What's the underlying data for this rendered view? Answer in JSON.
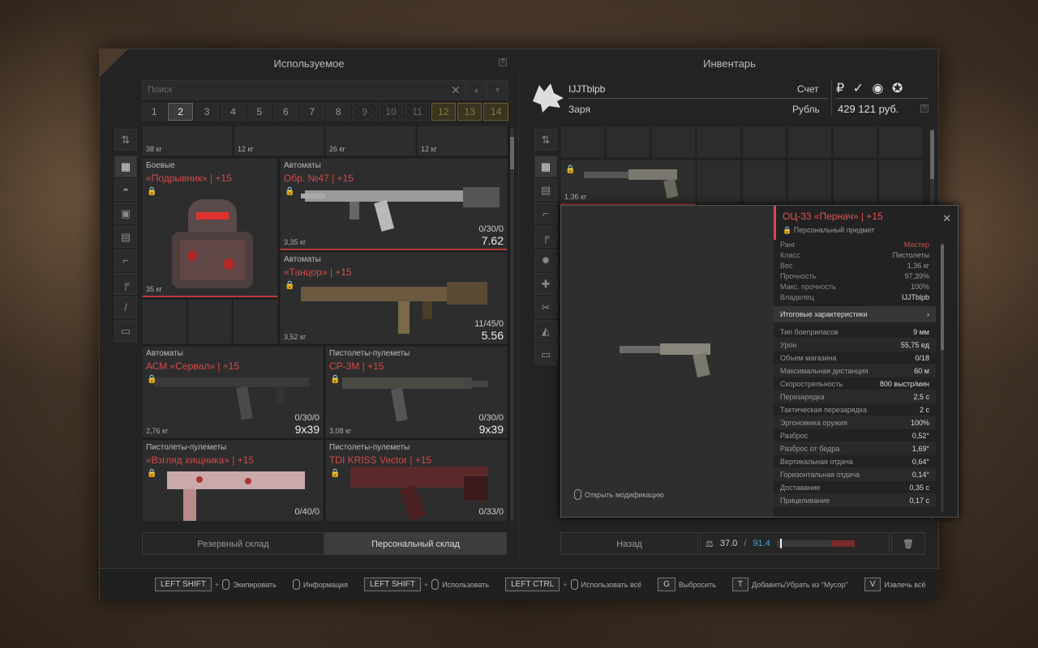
{
  "left_panel": {
    "title": "Используемое",
    "search_placeholder": "Поиск",
    "pages": [
      "1",
      "2",
      "3",
      "4",
      "5",
      "6",
      "7",
      "8",
      "9",
      "10",
      "11",
      "12",
      "13",
      "14"
    ],
    "active_page": "2",
    "top_weights": [
      "38 кг",
      "12 кг",
      "26 кг",
      "12 кг"
    ],
    "items": [
      {
        "category": "Боевые",
        "name": "«Подрывник» | +15",
        "weight": "35 кг",
        "ammo": "",
        "caliber": ""
      },
      {
        "category": "Автоматы",
        "name": "Обр. №47 | +15",
        "weight": "3,35 кг",
        "ammo": "0/30/0",
        "caliber": "7.62"
      },
      {
        "category": "Автоматы",
        "name": "«Танцор» | +15",
        "weight": "3,52 кг",
        "ammo": "11/45/0",
        "caliber": "5.56"
      },
      {
        "category": "Автоматы",
        "name": "АСМ «Сервал» | +15",
        "weight": "2,76 кг",
        "ammo": "0/30/0",
        "caliber": "9x39"
      },
      {
        "category": "Пистолеты-пулеметы",
        "name": "СР-3М | +15",
        "weight": "3,08 кг",
        "ammo": "0/30/0",
        "caliber": "9x39"
      },
      {
        "category": "Пистолеты-пулеметы",
        "name": "«Взгляд хищника» | +15",
        "weight": "",
        "ammo": "0/40/0",
        "caliber": ""
      },
      {
        "category": "Пистолеты-пулеметы",
        "name": "TDI KRISS Vector | +15",
        "weight": "",
        "ammo": "0/33/0",
        "caliber": ""
      }
    ],
    "tabs": [
      "Резервный склад",
      "Персональный склад"
    ],
    "active_tab": "Персональный склад"
  },
  "right_panel": {
    "title": "Инвентарь",
    "player_name": "IJJTblpb",
    "faction": "Заря",
    "account_label": "Счет",
    "currency_label": "Рубль",
    "money": "429 121 руб.",
    "inv_item_weight": "1,36 кг",
    "back_label": "Назад",
    "weight_current": "37.0",
    "weight_sep": "/",
    "weight_max": "91.4"
  },
  "popup": {
    "title": "ОЦ-33 «Пернач» | +15",
    "subtitle": "Персональный предмет",
    "open_mod": "Открыть модификацию",
    "info": [
      {
        "k": "Ранг",
        "v": "Мастер"
      },
      {
        "k": "Класс",
        "v": "Пистолеты"
      },
      {
        "k": "Вес",
        "v": "1,36 кг"
      },
      {
        "k": "Прочность",
        "v": "97,39%"
      },
      {
        "k": "Макс. прочность",
        "v": "100%"
      },
      {
        "k": "Владелец",
        "v": "IJJTblpb"
      }
    ],
    "summary_label": "Итоговые характеристики",
    "stats": [
      {
        "k": "Тип боеприпасов",
        "v": "9 мм"
      },
      {
        "k": "Урон",
        "v": "55,75 ед"
      },
      {
        "k": "Объем магазина",
        "v": "0/18"
      },
      {
        "k": "Максимальная дистанция",
        "v": "60 м"
      },
      {
        "k": "Скорострельность",
        "v": "800 выстр/мин"
      },
      {
        "k": "Перезарядка",
        "v": "2,5 с"
      },
      {
        "k": "Тактическая перезарядка",
        "v": "2 с"
      },
      {
        "k": "Эргономика оружия",
        "v": "100%"
      },
      {
        "k": "Разброс",
        "v": "0,52°"
      },
      {
        "k": "Разброс от бедра",
        "v": "1,69°"
      },
      {
        "k": "Вертикальная отдача",
        "v": "0,64°"
      },
      {
        "k": "Горизонтальная отдача",
        "v": "0,14°"
      },
      {
        "k": "Доставание",
        "v": "0,35 с"
      },
      {
        "k": "Прицеливание",
        "v": "0,17 с"
      }
    ]
  },
  "hints": [
    {
      "key": "LEFT SHIFT",
      "mouse": true,
      "text": "Экипировать"
    },
    {
      "key": "",
      "mouse": true,
      "text": "Информация"
    },
    {
      "key": "LEFT SHIFT",
      "mouse": true,
      "text": "Использовать"
    },
    {
      "key": "LEFT CTRL",
      "mouse": true,
      "text": "Использовать всё"
    },
    {
      "key": "G",
      "mouse": false,
      "text": "Выбросить"
    },
    {
      "key": "T",
      "mouse": false,
      "text": "Добавить/Убрать из \"Мусор\""
    },
    {
      "key": "V",
      "mouse": false,
      "text": "Извлечь всё"
    }
  ],
  "colors": {
    "accent_red": "#d44a4a",
    "gold_page": "#8a7a3a",
    "weight_max": "#4aa3d8"
  }
}
